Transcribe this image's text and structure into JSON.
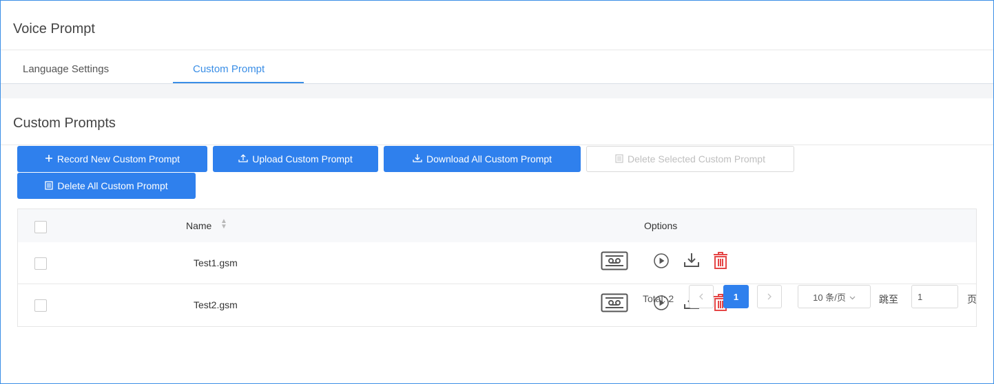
{
  "header": {
    "title": "Voice Prompt"
  },
  "tabs": [
    {
      "label": "Language Settings",
      "active": false
    },
    {
      "label": "Custom Prompt",
      "active": true
    }
  ],
  "section": {
    "title": "Custom Prompts"
  },
  "toolbar": {
    "record_label": "Record New Custom Prompt",
    "upload_label": "Upload Custom Prompt",
    "download_all_label": "Download All Custom Prompt",
    "delete_selected_label": "Delete Selected Custom Prompt",
    "delete_all_label": "Delete All Custom Prompt"
  },
  "table": {
    "columns": {
      "name": "Name",
      "options": "Options"
    },
    "rows": [
      {
        "name": "Test1.gsm"
      },
      {
        "name": "Test2.gsm"
      }
    ]
  },
  "pagination": {
    "total_label": "Total: 2",
    "current_page": "1",
    "page_size": "10 条/页",
    "jump_label": "跳至",
    "jump_value": "1",
    "page_suffix": "页"
  },
  "colors": {
    "accent": "#2f80ed",
    "delete": "#e54545",
    "border": "#3a8ee6"
  },
  "icons": [
    "plus-icon",
    "upload-icon",
    "download-icon",
    "trash-icon",
    "sort-icon",
    "record-icon",
    "play-icon",
    "download-icon",
    "delete-icon",
    "chevron-left-icon",
    "chevron-right-icon",
    "chevron-down-icon"
  ]
}
